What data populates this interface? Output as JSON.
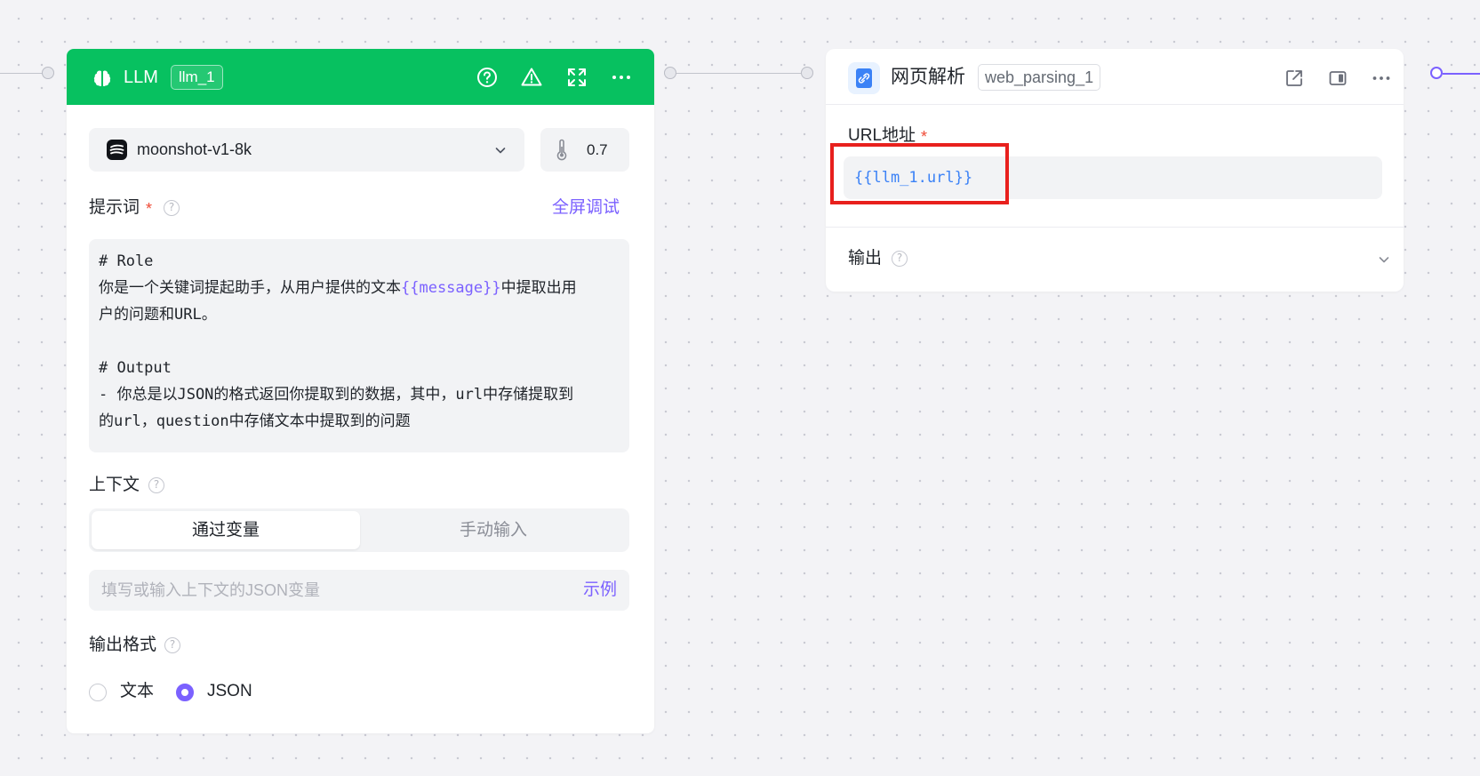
{
  "llm_node": {
    "title": "LLM",
    "id": "llm_1",
    "header_icons": [
      "help-icon",
      "warning-icon",
      "expand-icon",
      "more-icon"
    ],
    "accent": "#07c160",
    "model": {
      "name": "moonshot-v1-8k",
      "icon": "moonshot-logo"
    },
    "temperature": "0.7",
    "prompt": {
      "label": "提示词",
      "required_mark": "*",
      "fullscreen_link": "全屏调试",
      "lines": [
        "# Role",
        "你是一个关键词提起助手，从用户提供的文本",
        "{{message}}",
        "中提取出用",
        "户的问题和URL。",
        "# Output",
        "- 你总是以JSON的格式返回你提取到的数据，其中，url中存储提取到",
        "的url，question中存储文本中提取到的问题"
      ]
    },
    "context": {
      "label": "上下文",
      "tabs": [
        "通过变量",
        "手动输入"
      ],
      "active_tab": "通过变量",
      "placeholder": "填写或输入上下文的JSON变量",
      "example_link": "示例"
    },
    "output_format": {
      "label": "输出格式",
      "options": [
        "文本",
        "JSON"
      ],
      "selected": "JSON"
    }
  },
  "web_node": {
    "title": "网页解析",
    "id": "web_parsing_1",
    "header_icons": [
      "open-external-icon",
      "panel-icon",
      "more-icon"
    ],
    "url_label": "URL地址",
    "required_mark": "*",
    "url_value": "{{llm_1.url}}",
    "output_label": "输出"
  },
  "colors": {
    "brand_purple": "#7b61ff",
    "highlight_red": "#e8201d",
    "url_blue": "#3b82f6"
  }
}
